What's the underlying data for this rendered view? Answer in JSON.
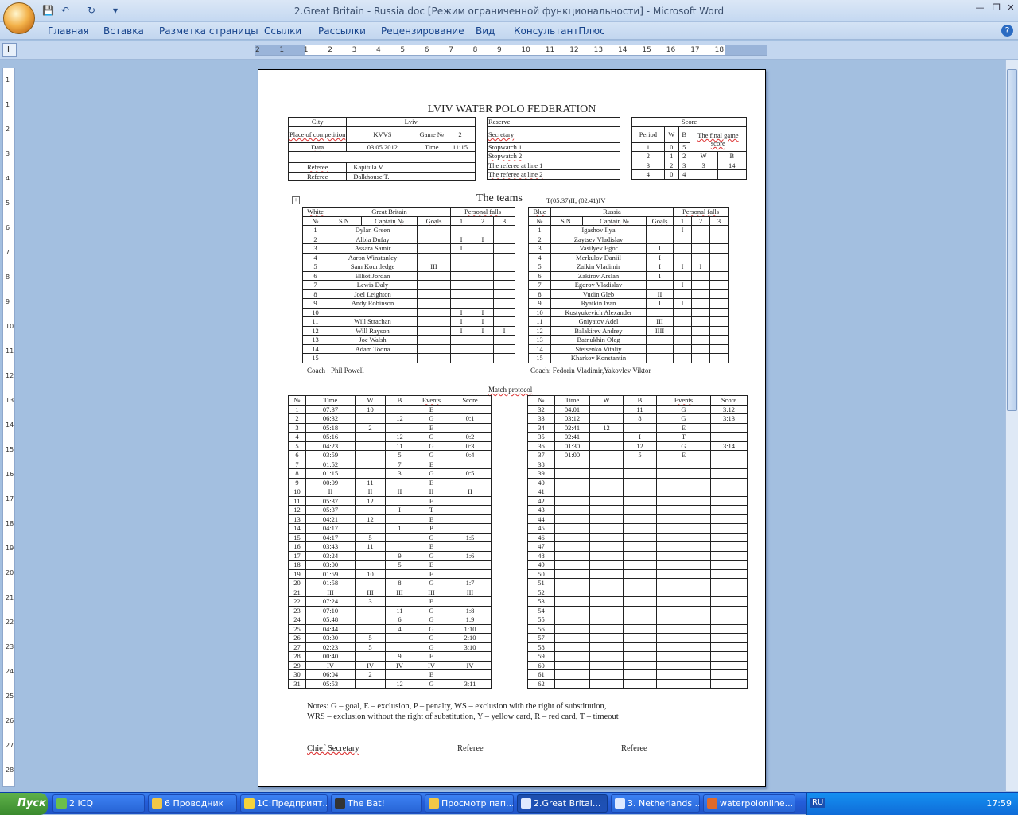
{
  "window": {
    "title": "2.Great Britain - Russia.doc [Режим ограниченной функциональности] - Microsoft Word"
  },
  "menu": [
    "Главная",
    "Вставка",
    "Разметка страницы",
    "Ссылки",
    "Рассылки",
    "Рецензирование",
    "Вид",
    "КонсультантПлюс"
  ],
  "ruler": {
    "h_labels": [
      "2",
      "1",
      "1",
      "2",
      "3",
      "4",
      "5",
      "6",
      "7",
      "8",
      "9",
      "10",
      "11",
      "12",
      "13",
      "14",
      "15",
      "16",
      "17",
      "18"
    ],
    "v_labels": [
      "1",
      "1",
      "2",
      "3",
      "4",
      "5",
      "6",
      "7",
      "8",
      "9",
      "10",
      "11",
      "12",
      "13",
      "14",
      "15",
      "16",
      "17",
      "18",
      "19",
      "20",
      "21",
      "22",
      "23",
      "24",
      "25",
      "26",
      "27",
      "28"
    ]
  },
  "doc": {
    "title": "LVIV WATER POLO FEDERATION",
    "info": [
      [
        "City",
        "Lviv",
        "",
        ""
      ],
      [
        "Place of competition",
        "KVVS",
        "Game №",
        "2"
      ],
      [
        "Data",
        "03.05.2012",
        "Time",
        "11:15"
      ]
    ],
    "referees": [
      [
        "Referee",
        "Kapitula V."
      ],
      [
        "Referee",
        "Dalkhouse T."
      ]
    ],
    "reserve": [
      "Reserve",
      "Secretary",
      "Stopwatch 1",
      "Stopwatch 2",
      "The referee at line 1",
      "The referee at line 2"
    ],
    "score": {
      "header": "Score",
      "cols": [
        "Period",
        "W",
        "B"
      ],
      "final": "The final game score",
      "final_cols": [
        "W",
        "B"
      ],
      "rows": [
        [
          "1",
          "0",
          "5"
        ],
        [
          "2",
          "1",
          "2"
        ],
        [
          "3",
          "2",
          "3"
        ],
        [
          "4",
          "0",
          "4"
        ]
      ],
      "final_vals": [
        "3",
        "14"
      ]
    },
    "teams_title": "The teams",
    "timeouts": "T(05:37)II; (02:41)IV",
    "team_headers": {
      "sn": "S.N.",
      "captain": "Captain №",
      "goals": "Goals",
      "pf": "Personal falls",
      "no": "№",
      "pf_cols": [
        "1",
        "2",
        "3"
      ]
    },
    "white": {
      "color": "White",
      "name": "Great Britain",
      "coach": "Coach : Phil Powell",
      "players": [
        [
          "1",
          "Dylan Green",
          "",
          "",
          "",
          ""
        ],
        [
          "2",
          "Albia Dufay",
          "",
          "I",
          "I",
          ""
        ],
        [
          "3",
          "Assara Samir",
          "",
          "I",
          "",
          ""
        ],
        [
          "4",
          "Aaron Winstanley",
          "",
          "",
          "",
          ""
        ],
        [
          "5",
          "Sam Kourtledge",
          "III",
          "",
          "",
          ""
        ],
        [
          "6",
          "Elliot Jordan",
          "",
          "",
          "",
          ""
        ],
        [
          "7",
          "Lewis Daly",
          "",
          "",
          "",
          ""
        ],
        [
          "8",
          "Joel Leighton",
          "",
          "",
          "",
          ""
        ],
        [
          "9",
          "Andy Robinson",
          "",
          "",
          "",
          ""
        ],
        [
          "10",
          "",
          "",
          "I",
          "I",
          ""
        ],
        [
          "11",
          "Will Strachan",
          "",
          "I",
          "I",
          ""
        ],
        [
          "12",
          "Will Rayson",
          "",
          "I",
          "I",
          "I"
        ],
        [
          "13",
          "Joe Walsh",
          "",
          "",
          "",
          ""
        ],
        [
          "14",
          "Adam Toona",
          "",
          "",
          "",
          ""
        ],
        [
          "15",
          "",
          "",
          "",
          "",
          ""
        ]
      ]
    },
    "blue": {
      "color": "Blue",
      "name": "Russia",
      "coach": "Coach: Fedorin Vladimir,Yakovlev Viktor",
      "players": [
        [
          "1",
          "Igashov Ilya",
          "",
          "I",
          "",
          ""
        ],
        [
          "2",
          "Zaytsev Vladislav",
          "",
          "",
          "",
          ""
        ],
        [
          "3",
          "Vasilyev Egor",
          "I",
          "",
          "",
          ""
        ],
        [
          "4",
          "Merkulov Daniil",
          "I",
          "",
          "",
          ""
        ],
        [
          "5",
          "Zaikin Vladimir",
          "I",
          "I",
          "I",
          ""
        ],
        [
          "6",
          "Zakirov Arslan",
          "I",
          "",
          "",
          ""
        ],
        [
          "7",
          "Egorov Vladislav",
          "",
          "I",
          "",
          ""
        ],
        [
          "8",
          "Vudin Gleb",
          "II",
          "",
          "",
          ""
        ],
        [
          "9",
          "Ryatkin Ivan",
          "I",
          "I",
          "",
          ""
        ],
        [
          "10",
          "Kostyukevich Alexander",
          "",
          "",
          "",
          ""
        ],
        [
          "11",
          "Gniyatov Adel",
          "III",
          "",
          "",
          ""
        ],
        [
          "12",
          "Balakirev Andrey",
          "IIII",
          "",
          "",
          ""
        ],
        [
          "13",
          "Batnukhin Oleg",
          "",
          "",
          "",
          ""
        ],
        [
          "14",
          "Stetsenko Vitaliy",
          "",
          "",
          "",
          ""
        ],
        [
          "15",
          "Kharkov Konstantin",
          "",
          "",
          "",
          ""
        ]
      ]
    },
    "protocol_title": "Match protocol",
    "protocol_cols": [
      "№",
      "Time",
      "W",
      "B",
      "Events",
      "Score"
    ],
    "protocol_left": [
      [
        "1",
        "07:37",
        "10",
        "",
        "E",
        ""
      ],
      [
        "2",
        "06:32",
        "",
        "12",
        "G",
        "0:1"
      ],
      [
        "3",
        "05:18",
        "2",
        "",
        "E",
        ""
      ],
      [
        "4",
        "05:16",
        "",
        "12",
        "G",
        "0:2"
      ],
      [
        "5",
        "04:23",
        "",
        "11",
        "G",
        "0:3"
      ],
      [
        "6",
        "03:59",
        "",
        "5",
        "G",
        "0:4"
      ],
      [
        "7",
        "01:52",
        "",
        "7",
        "E",
        ""
      ],
      [
        "8",
        "01:15",
        "",
        "3",
        "G",
        "0:5"
      ],
      [
        "9",
        "00:09",
        "11",
        "",
        "E",
        ""
      ],
      [
        "10",
        "II",
        "II",
        "II",
        "II",
        "II"
      ],
      [
        "11",
        "05:37",
        "12",
        "",
        "E",
        ""
      ],
      [
        "12",
        "05:37",
        "",
        "I",
        "T",
        ""
      ],
      [
        "13",
        "04:21",
        "12",
        "",
        "E",
        ""
      ],
      [
        "14",
        "04:17",
        "",
        "1",
        "P",
        ""
      ],
      [
        "15",
        "04:17",
        "5",
        "",
        "G",
        "1:5"
      ],
      [
        "16",
        "03:43",
        "11",
        "",
        "E",
        ""
      ],
      [
        "17",
        "03:24",
        "",
        "9",
        "G",
        "1:6"
      ],
      [
        "18",
        "03:00",
        "",
        "5",
        "E",
        ""
      ],
      [
        "19",
        "01:59",
        "10",
        "",
        "E",
        ""
      ],
      [
        "20",
        "01:58",
        "",
        "8",
        "G",
        "1:7"
      ],
      [
        "21",
        "III",
        "III",
        "III",
        "III",
        "III"
      ],
      [
        "22",
        "07:24",
        "3",
        "",
        "E",
        ""
      ],
      [
        "23",
        "07:10",
        "",
        "11",
        "G",
        "1:8"
      ],
      [
        "24",
        "05:48",
        "",
        "6",
        "G",
        "1:9"
      ],
      [
        "25",
        "04:44",
        "",
        "4",
        "G",
        "1:10"
      ],
      [
        "26",
        "03:30",
        "5",
        "",
        "G",
        "2:10"
      ],
      [
        "27",
        "02:23",
        "5",
        "",
        "G",
        "3:10"
      ],
      [
        "28",
        "00:40",
        "",
        "9",
        "E",
        ""
      ],
      [
        "29",
        "IV",
        "IV",
        "IV",
        "IV",
        "IV"
      ],
      [
        "30",
        "06:04",
        "2",
        "",
        "E",
        ""
      ],
      [
        "31",
        "05:53",
        "",
        "12",
        "G",
        "3:11"
      ]
    ],
    "protocol_right": [
      [
        "32",
        "04:01",
        "",
        "11",
        "G",
        "3:12"
      ],
      [
        "33",
        "03:12",
        "",
        "8",
        "G",
        "3:13"
      ],
      [
        "34",
        "02:41",
        "12",
        "",
        "E",
        ""
      ],
      [
        "35",
        "02:41",
        "",
        "I",
        "T",
        ""
      ],
      [
        "36",
        "01:30",
        "",
        "12",
        "G",
        "3:14"
      ],
      [
        "37",
        "01:00",
        "",
        "5",
        "E",
        ""
      ],
      [
        "38",
        "",
        "",
        "",
        "",
        ""
      ],
      [
        "39",
        "",
        "",
        "",
        "",
        ""
      ],
      [
        "40",
        "",
        "",
        "",
        "",
        ""
      ],
      [
        "41",
        "",
        "",
        "",
        "",
        ""
      ],
      [
        "42",
        "",
        "",
        "",
        "",
        ""
      ],
      [
        "43",
        "",
        "",
        "",
        "",
        ""
      ],
      [
        "44",
        "",
        "",
        "",
        "",
        ""
      ],
      [
        "45",
        "",
        "",
        "",
        "",
        ""
      ],
      [
        "46",
        "",
        "",
        "",
        "",
        ""
      ],
      [
        "47",
        "",
        "",
        "",
        "",
        ""
      ],
      [
        "48",
        "",
        "",
        "",
        "",
        ""
      ],
      [
        "49",
        "",
        "",
        "",
        "",
        ""
      ],
      [
        "50",
        "",
        "",
        "",
        "",
        ""
      ],
      [
        "51",
        "",
        "",
        "",
        "",
        ""
      ],
      [
        "52",
        "",
        "",
        "",
        "",
        ""
      ],
      [
        "53",
        "",
        "",
        "",
        "",
        ""
      ],
      [
        "54",
        "",
        "",
        "",
        "",
        ""
      ],
      [
        "55",
        "",
        "",
        "",
        "",
        ""
      ],
      [
        "56",
        "",
        "",
        "",
        "",
        ""
      ],
      [
        "57",
        "",
        "",
        "",
        "",
        ""
      ],
      [
        "58",
        "",
        "",
        "",
        "",
        ""
      ],
      [
        "59",
        "",
        "",
        "",
        "",
        ""
      ],
      [
        "60",
        "",
        "",
        "",
        "",
        ""
      ],
      [
        "61",
        "",
        "",
        "",
        "",
        ""
      ],
      [
        "62",
        "",
        "",
        "",
        "",
        ""
      ]
    ],
    "notes_1": "Notes: G – goal, E – exclusion, P – penalty, WS – exclusion with the right of substitution,",
    "notes_2": "WRS – exclusion without the right of substitution, Y – yellow card,  R – red card, T – timeout",
    "signatures": [
      "Chief Secretary",
      "Referee",
      "Referee"
    ]
  },
  "taskbar": {
    "start": "Пуск",
    "tasks": [
      "2 ICQ",
      "6 Проводник",
      "1С:Предприят...",
      "The Bat!",
      "Просмотр пап...",
      "2.Great Britai...",
      "3. Netherlands ...",
      "waterpolonline..."
    ],
    "lang": "RU",
    "clock": "17:59"
  }
}
